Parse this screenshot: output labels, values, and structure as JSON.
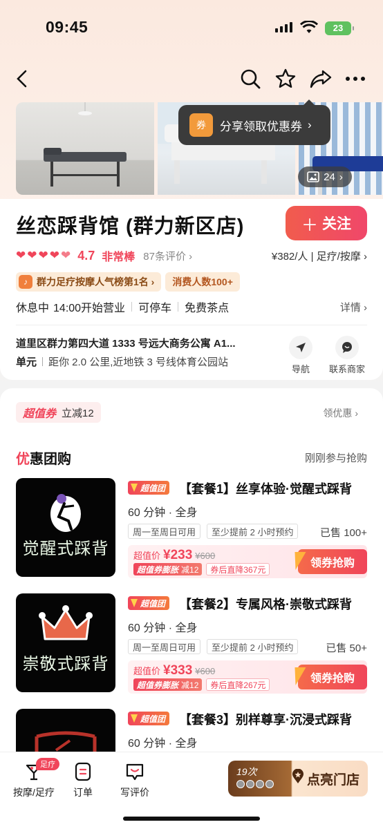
{
  "status": {
    "time": "09:45",
    "battery": "23"
  },
  "nav": {
    "icons": [
      "back-icon",
      "search-icon",
      "star-icon",
      "share-icon",
      "more-icon"
    ]
  },
  "gallery": {
    "photo_count": "24"
  },
  "share_tip": {
    "icon_text": "券",
    "text": "分享领取优惠券",
    "chevron": "›"
  },
  "shop": {
    "name": "丝恋踩背馆 (群力新区店)",
    "follow_label": "关注",
    "score": "4.7",
    "score_label": "非常棒",
    "reviews": "87条评价 ›",
    "price_category": "¥382/人 | 足疗/按摩 ›",
    "rank_tag": "群力足疗按摩人气榜第1名 ›",
    "consume_tag": "消费人数100+",
    "status": "休息中",
    "open_time": "14:00开始营业",
    "parking": "可停车",
    "tea": "免费茶点",
    "detail": "详情 ›",
    "address_line1": "道里区群力第四大道 1333 号远大商务公寓 A1...",
    "address_unit": "单元",
    "address_distance": "距你 2.0 公里,近地铁 3 号线体育公园站",
    "nav_label": "导航",
    "contact_label": "联系商家"
  },
  "deals": {
    "coupon_chip_hot": "超值券",
    "coupon_chip_text": "立减12",
    "get_coupon": "领优惠 ›",
    "title_first": "优",
    "title_rest": "惠团购",
    "subtitle": "刚刚参与抢购",
    "items": [
      {
        "badge": "超值团",
        "title": "【套餐1】丝享体验·觉醒式踩背",
        "sub": "60 分钟 · 全身",
        "chip1": "周一至周日可用",
        "chip2": "至少提前 2 小时预约",
        "sold": "已售 100+",
        "price_label": "超值价",
        "price": "¥233",
        "old_price": "¥600",
        "bubble_strong": "超值券膨胀",
        "bubble_rest": "减12",
        "after": "券后直降367元",
        "buy": "领券抢购",
        "thumb_text": "觉醒式踩背"
      },
      {
        "badge": "超值团",
        "title": "【套餐2】专属风格·崇敬式踩背",
        "sub": "60 分钟 · 全身",
        "chip1": "周一至周日可用",
        "chip2": "至少提前 2 小时预约",
        "sold": "已售 50+",
        "price_label": "超值价",
        "price": "¥333",
        "old_price": "¥600",
        "bubble_strong": "超值券膨胀",
        "bubble_rest": "减12",
        "after": "券后直降267元",
        "buy": "领券抢购",
        "thumb_text": "崇敬式踩背"
      },
      {
        "badge": "超值团",
        "title": "【套餐3】别样尊享·沉浸式踩背",
        "sub": "60 分钟 · 全身"
      }
    ]
  },
  "tabbar": {
    "massage_label": "按摩/足疗",
    "massage_badge": "足疗",
    "orders_label": "订单",
    "review_label": "写评价",
    "promo_count": "19次",
    "promo_text": "点亮门店"
  },
  "colors": {
    "accent": "#f0455a",
    "follow": "#f15c4d",
    "tag_bg": "#fcebd8"
  }
}
